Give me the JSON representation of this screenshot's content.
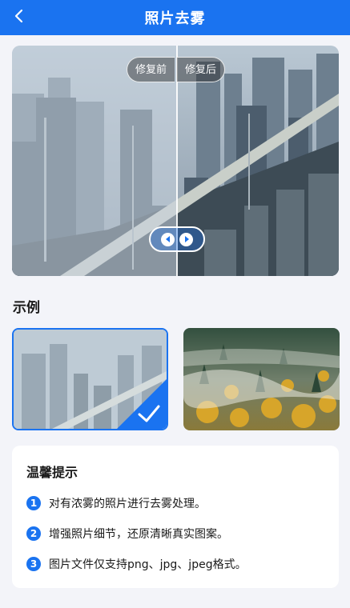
{
  "header": {
    "title": "照片去雾",
    "back_icon": "chevron-left-icon",
    "background": "#1a73f0"
  },
  "compare": {
    "before_label": "修复前",
    "after_label": "修复后",
    "handle_icon": "left-right-arrows-icon"
  },
  "examples": {
    "title": "示例",
    "items": [
      {
        "name": "hazy-city",
        "selected": true
      },
      {
        "name": "foggy-forest",
        "selected": false
      }
    ]
  },
  "tips": {
    "title": "温馨提示",
    "items": [
      {
        "num": "1",
        "text": "对有浓雾的照片进行去雾处理。"
      },
      {
        "num": "2",
        "text": "增强照片细节，还原清晰真实图案。"
      },
      {
        "num": "3",
        "text": "图片文件仅支持png、jpg、jpeg格式。"
      }
    ]
  },
  "colors": {
    "accent": "#1a73f0",
    "page_bg": "#f3f4f9"
  }
}
